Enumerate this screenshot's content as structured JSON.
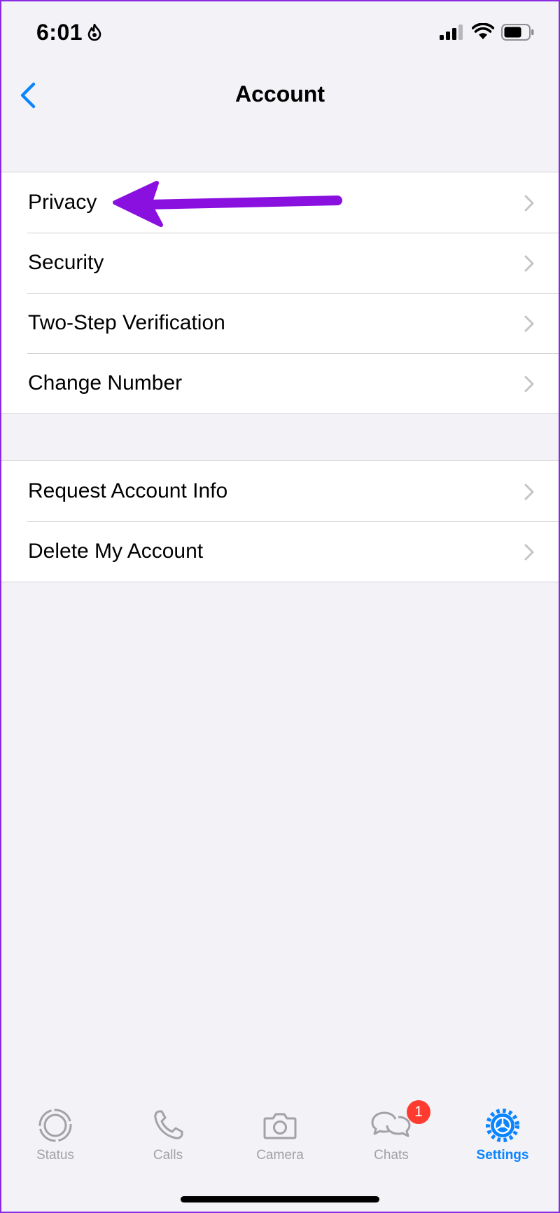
{
  "status_bar": {
    "time": "6:01"
  },
  "nav": {
    "title": "Account",
    "back_icon": "chevron-left-icon"
  },
  "groups": [
    {
      "rows": [
        {
          "label": "Privacy"
        },
        {
          "label": "Security"
        },
        {
          "label": "Two-Step Verification"
        },
        {
          "label": "Change Number"
        }
      ]
    },
    {
      "rows": [
        {
          "label": "Request Account Info"
        },
        {
          "label": "Delete My Account"
        }
      ]
    }
  ],
  "annotation": {
    "type": "arrow",
    "color": "#8a10e0",
    "points_to": "Privacy"
  },
  "tab_bar": {
    "tabs": [
      {
        "label": "Status",
        "icon": "status-icon",
        "active": false
      },
      {
        "label": "Calls",
        "icon": "phone-icon",
        "active": false
      },
      {
        "label": "Camera",
        "icon": "camera-icon",
        "active": false
      },
      {
        "label": "Chats",
        "icon": "chat-bubbles-icon",
        "active": false,
        "badge": "1"
      },
      {
        "label": "Settings",
        "icon": "gear-icon",
        "active": true
      }
    ]
  },
  "colors": {
    "accent": "#0a84ff",
    "badge": "#ff3b30",
    "background": "#f2f2f7",
    "inactive_tab": "#a2a2a6"
  }
}
